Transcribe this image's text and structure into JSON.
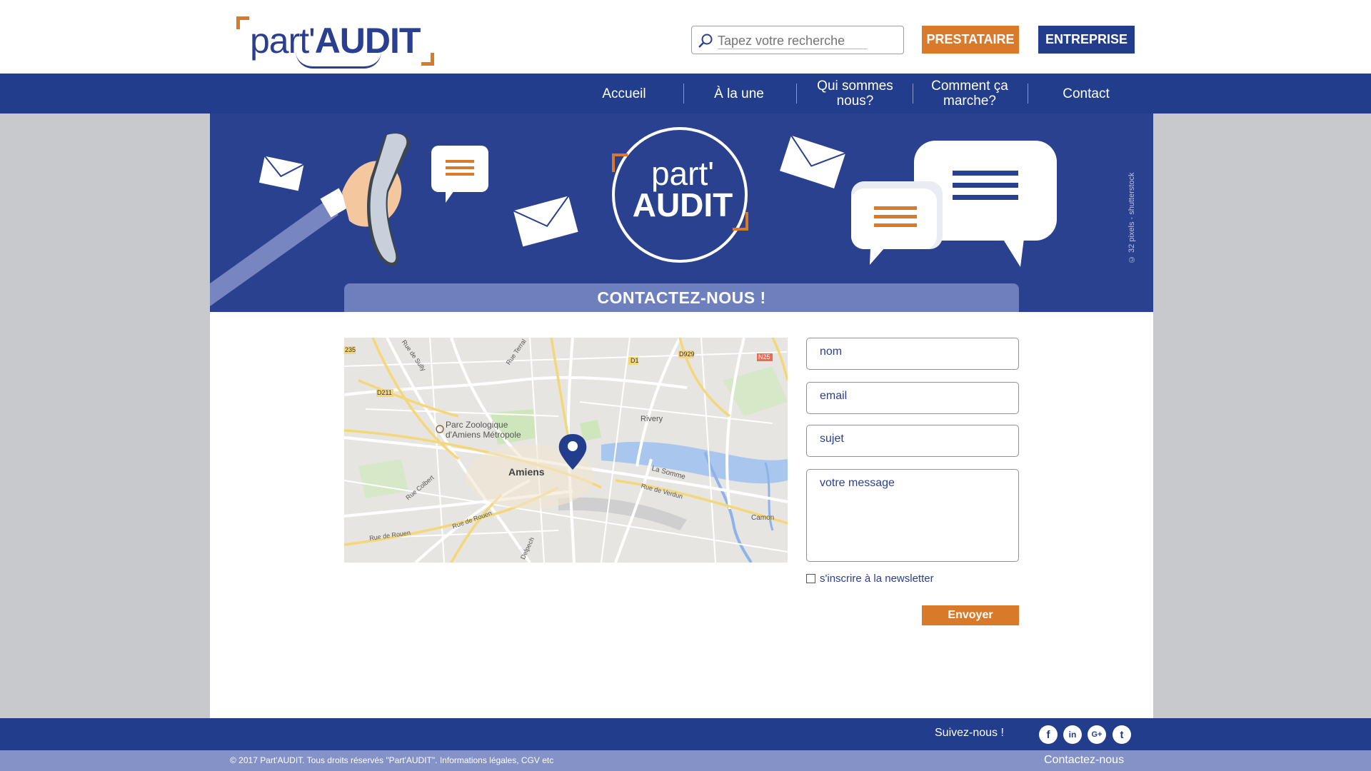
{
  "header": {
    "logo_part": "part'",
    "logo_audit": "AUDIT",
    "search_placeholder": "Tapez votre recherche",
    "btn_prestataire": "PRESTATAIRE",
    "btn_entreprise": "ENTREPRISE"
  },
  "nav": {
    "items": [
      {
        "label": "Accueil"
      },
      {
        "label": "À la une"
      },
      {
        "label": "Qui sommes nous?"
      },
      {
        "label": "Comment ça marche?"
      },
      {
        "label": "Contact"
      }
    ]
  },
  "banner": {
    "credit": "© 32 pixels - shutterstock",
    "center_logo_part": "part'",
    "center_logo_audit": "AUDIT",
    "contact_title": "CONTACTEZ-NOUS !"
  },
  "map": {
    "labels": {
      "zoo": "Parc Zoologique",
      "zoo2": "d'Amiens Métropole",
      "city": "Amiens",
      "rivery": "Rivery",
      "camon": "Camon",
      "somme": "La Somme",
      "rouen1": "Rue de Rouen",
      "rouen2": "Rue de Rouen",
      "verdun": "Rue de Verdun",
      "d1": "D1",
      "d929": "D929",
      "n25": "N25",
      "d211": "D211",
      "d235": "235",
      "sully": "Rue de Sully",
      "terral": "Rue Terral",
      "colbert": "Rue Colbert",
      "delpech": "Delpech"
    },
    "pin_color": "#233d8d"
  },
  "form": {
    "nom_placeholder": "nom",
    "email_placeholder": "email",
    "sujet_placeholder": "sujet",
    "message_placeholder": "votre message",
    "newsletter_label": "s'inscrire à la newsletter",
    "send_label": "Envoyer"
  },
  "footer": {
    "follow": "Suivez-nous !",
    "social": [
      "f",
      "in",
      "G+",
      "t"
    ],
    "copyright": "© 2017 Part'AUDIT. Tous droits réservés \"Part'AUDIT\". Informations légales, CGV etc",
    "contact_link": "Contactez-nous"
  },
  "colors": {
    "brand_blue": "#233d8d",
    "brand_orange": "#d97a2b",
    "light_blue": "#6e7fbd"
  }
}
